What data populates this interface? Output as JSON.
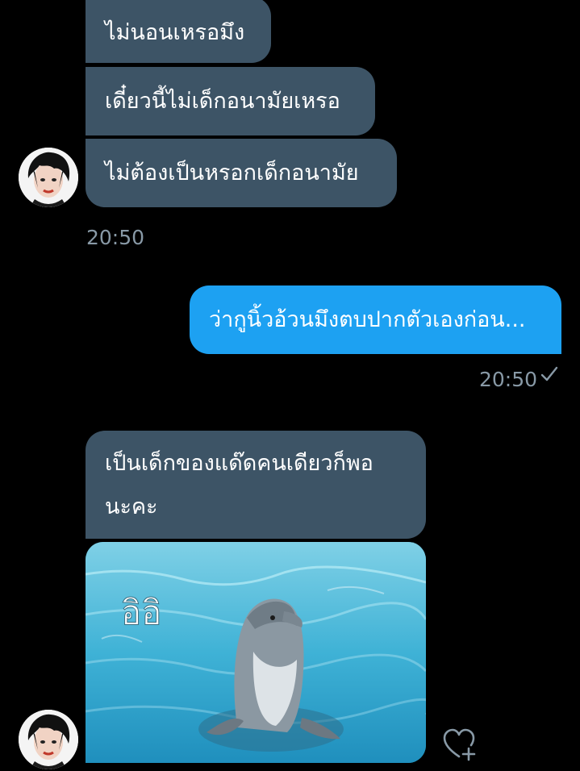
{
  "conversation": {
    "messages": [
      {
        "side": "incoming",
        "text": "ไม่นอนเหรอมึง"
      },
      {
        "side": "incoming",
        "text": "เดี๋ยวนี้ไม่เด็กอนามัยเหรอ"
      },
      {
        "side": "incoming",
        "text": "ไม่ต้องเป็นหรอกเด็กอนามัย"
      },
      {
        "side": "outgoing",
        "text": "ว่ากูนิ้วอ้วนมึงตบปากตัวเองก่อน..."
      },
      {
        "side": "incoming",
        "line1": "เป็นเด็กของแด๊ดคนเดียวก็พอ",
        "line2": "นะคะ"
      }
    ],
    "timestamps": {
      "incoming_group": "20:50",
      "outgoing": "20:50"
    },
    "image_message": {
      "caption": "อิอิ",
      "subject": "dolphin-photo"
    }
  },
  "icons": {
    "avatar": "avatar-icon",
    "read_check": "check-icon",
    "react": "heart-add-icon"
  },
  "colors": {
    "background": "#000000",
    "incoming_bubble": "#3d5466",
    "outgoing_bubble": "#1da1f2",
    "timestamp": "#8899a6"
  }
}
